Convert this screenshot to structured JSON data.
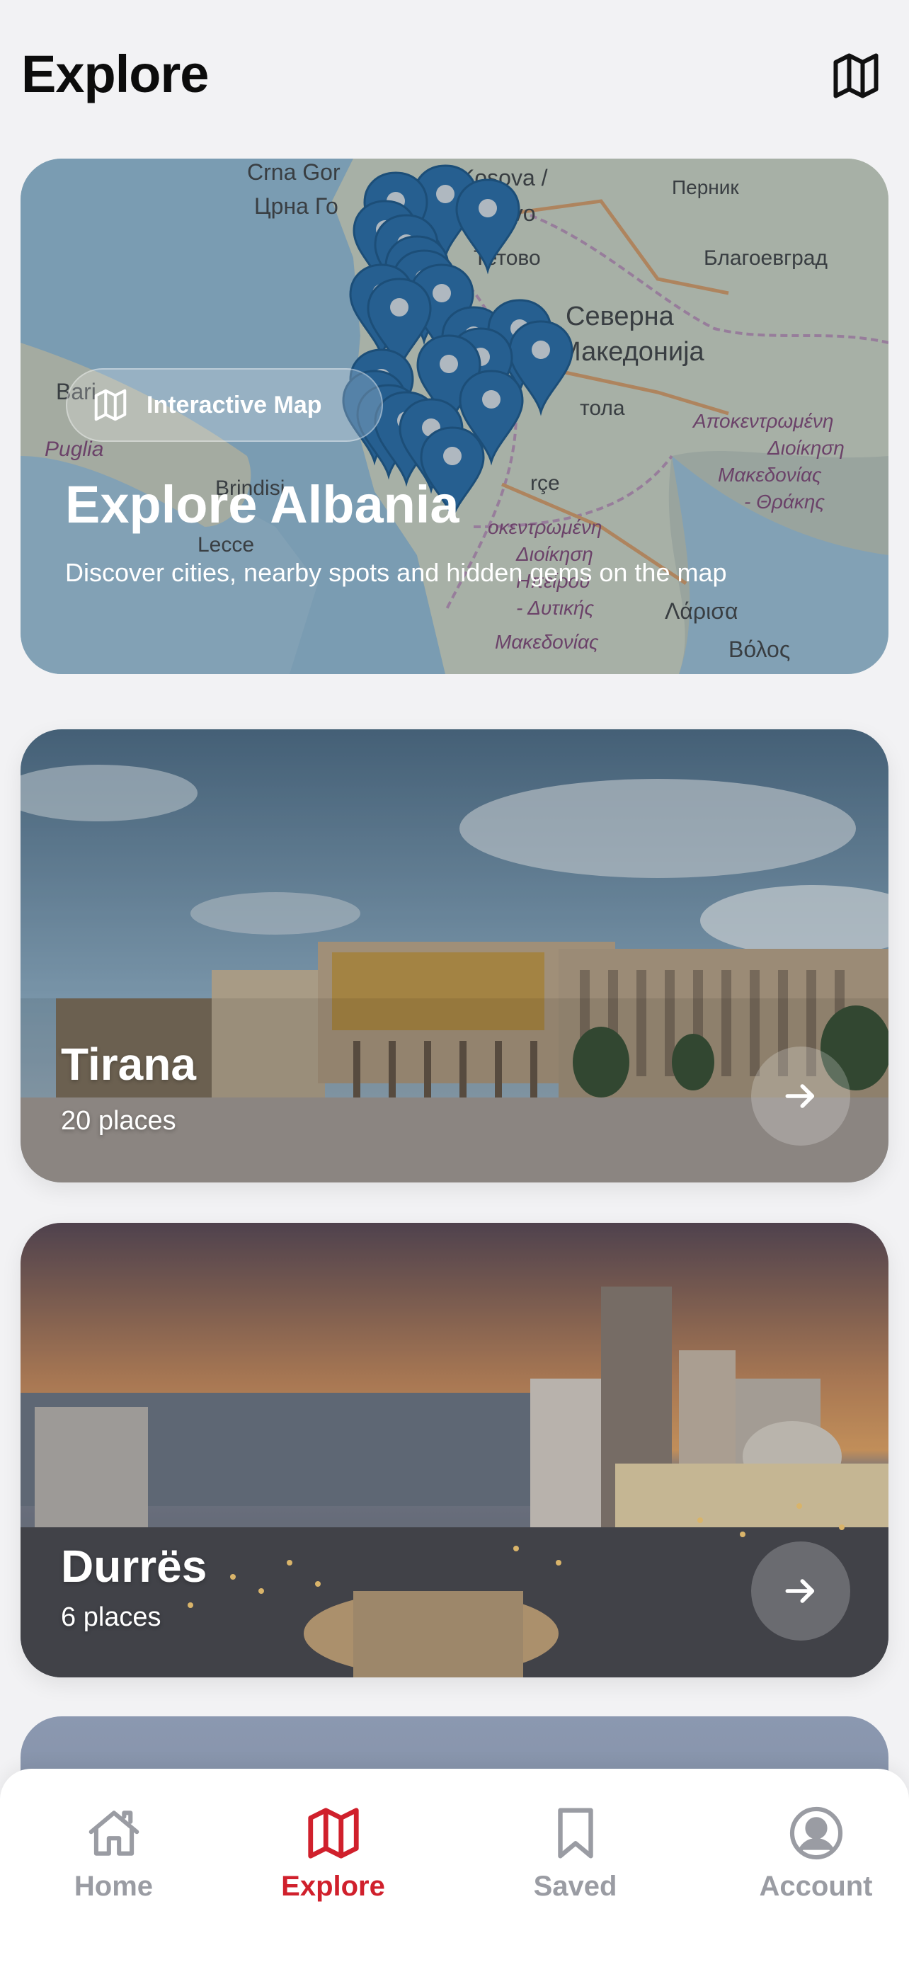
{
  "header": {
    "title": "Explore",
    "map_icon": "map-icon"
  },
  "map_card": {
    "chip_label": "Interactive Map",
    "title": "Explore Albania",
    "description": "Discover cities, nearby spots and hidden gems on the map",
    "map_labels": {
      "top_left": "Crna Gor",
      "top_left2": "Црна Го",
      "kosovo": "Kosova /",
      "kosovo2": "sovo",
      "pernik": "Перник",
      "tetovo": "Тетово",
      "blagoevgrad": "Благоевград",
      "severna": "Северна",
      "makedonija": "Македонија",
      "ohrid": "тола",
      "bari": "Bari",
      "puglia": "Puglia",
      "brindisi": "Brindisi",
      "lecce": "Lecce",
      "korce": "rçe",
      "greek1": "Αποκεντρωμένη",
      "greek2": "Διοίκηση",
      "greek3": "Μακεδονίας",
      "greek4": "- Θράκης",
      "greek5": "οκεντρωμένη",
      "greek6": "Διοίκηση",
      "greek7": "Ηπείρου",
      "greek8": "- Δυτικής",
      "greek9": "Μακεδονίας",
      "larisa": "Λάρισα",
      "volos": "Βόλος"
    }
  },
  "cities": [
    {
      "name": "Tirana",
      "count": "20 places"
    },
    {
      "name": "Durrës",
      "count": "6 places"
    }
  ],
  "tabbar": {
    "items": [
      {
        "label": "Home",
        "icon": "home-icon",
        "active": false
      },
      {
        "label": "Explore",
        "icon": "map-icon",
        "active": true
      },
      {
        "label": "Saved",
        "icon": "bookmark-icon",
        "active": false
      },
      {
        "label": "Account",
        "icon": "account-icon",
        "active": false
      }
    ]
  },
  "colors": {
    "accent": "#d0202c",
    "inactive": "#9a9ca3",
    "pin": "#2a72b0"
  }
}
